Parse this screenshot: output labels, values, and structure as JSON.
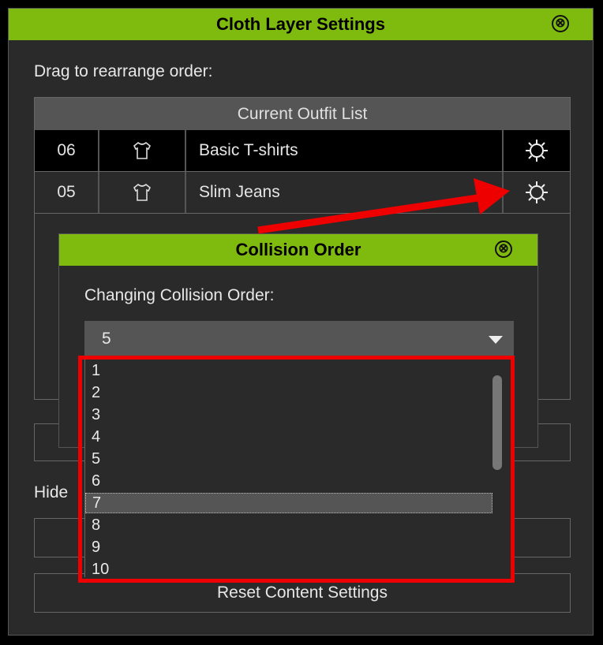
{
  "main_window": {
    "title": "Cloth Layer Settings",
    "close_glyph": "⊗",
    "drag_label": "Drag to rearrange order:",
    "outfit_list_header": "Current Outfit List",
    "rows": [
      {
        "order": "06",
        "icon": "tshirt-icon",
        "name": "Basic T-shirts",
        "settings_icon": "gear-icon",
        "selected": true
      },
      {
        "order": "05",
        "icon": "tshirt-icon",
        "name": "Slim Jeans",
        "settings_icon": "gear-icon",
        "selected": false
      }
    ],
    "hide_label": "Hide",
    "reset_button": "Reset Content Settings"
  },
  "dialog": {
    "title": "Collision Order",
    "close_glyph": "⊗",
    "changing_label": "Changing Collision Order:",
    "selected_value": "5",
    "options": [
      "1",
      "2",
      "3",
      "4",
      "5",
      "6",
      "7",
      "8",
      "9",
      "10"
    ],
    "highlighted_option": "7"
  },
  "colors": {
    "titlebar": "#7fba0f",
    "annotation": "#ee0000"
  }
}
